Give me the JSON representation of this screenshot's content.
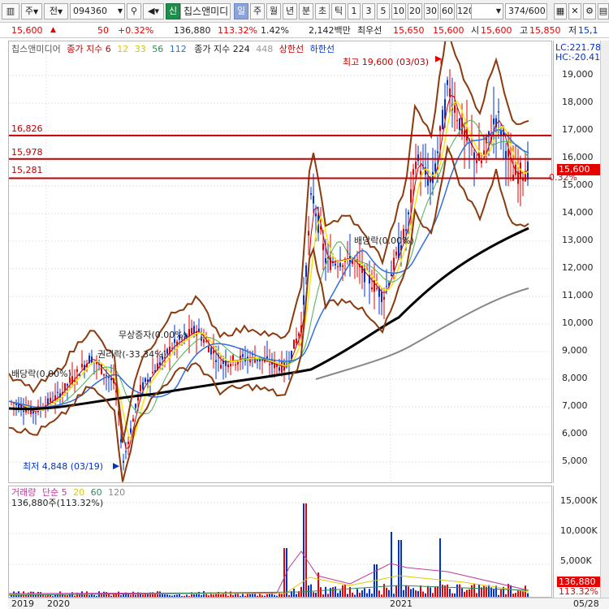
{
  "toolbar": {
    "market_label": "주",
    "period_label": "전",
    "code": "094360",
    "badge_new": "신",
    "stock_name": "칩스앤미디",
    "tab_day": "일",
    "tab_week": "주",
    "tab_month": "월",
    "tab_year": "년",
    "tab_min": "분",
    "tab_sec": "초",
    "tab_tick": "틱",
    "intervals": [
      "1",
      "3",
      "5",
      "10",
      "20",
      "30",
      "60",
      "120"
    ],
    "count_value": "374",
    "count_total": "/600"
  },
  "quote": {
    "price": "15,600",
    "arrow": "▲",
    "change": "50",
    "change_pct": "+0.32%",
    "volume": "136,880",
    "volume_ratio": "113.32%",
    "turnover": "1.42%",
    "amount": "2,142백만",
    "best_ask_label": "최우선",
    "best_ask": "15,650",
    "best_bid": "15,600",
    "open_label": "시",
    "open": "15,600",
    "high_label": "고",
    "high": "15,850",
    "low_label": "저",
    "low": "15,1"
  },
  "price_legend": {
    "name": "칩스앤미디어",
    "ma_label": "종가 지수",
    "ma": [
      "6",
      "12",
      "33",
      "56",
      "112"
    ],
    "ma2_label": "종가 지수",
    "ma2": [
      "224",
      "448"
    ],
    "limit_up": "상한선",
    "limit_down": "하한선"
  },
  "annotations": {
    "high": "최고 19,600 (03/03)",
    "low": "최저 4,848 (03/19)",
    "ex_div1": "배당락(0.00%)",
    "ex_div2": "배당락(0.00%)",
    "ex_rights1": "무상증자(0.00%)",
    "ex_rights2": "권리락(-33.34%)"
  },
  "levels": [
    "16,826",
    "15,978",
    "15,281"
  ],
  "price_axis": {
    "ticks": [
      "19,000",
      "18,000",
      "17,000",
      "16,000",
      "15,000",
      "14,000",
      "13,000",
      "12,000",
      "11,000",
      "10,000",
      "9,000",
      "8,000",
      "7,000",
      "6,000",
      "5,000"
    ],
    "lc": "LC:221.78",
    "hc": "HC:-20.41",
    "current": "15,600",
    "current_pct": "0.32%"
  },
  "vol_legend": {
    "label": "거래량",
    "ma_label": "단순",
    "ma": [
      "5",
      "20",
      "60",
      "120"
    ],
    "value": "136,880주(113.32%)"
  },
  "vol_axis": {
    "ticks": [
      "15,000K",
      "10,000K",
      "5,000K"
    ],
    "current": "136,880",
    "current_pct": "113.32%"
  },
  "x_axis": [
    "2019",
    "2020",
    "2021",
    "05/28"
  ],
  "colors": {
    "up": "#e60000",
    "down": "#0033cc",
    "ma6": "#c00000",
    "ma12": "#f5e600",
    "ma33": "#4caf50",
    "ma56": "#2f6fe0",
    "ma112": "#000000",
    "ma224": "#888888",
    "band": "#8b3a0e",
    "level": "#c00000"
  }
}
